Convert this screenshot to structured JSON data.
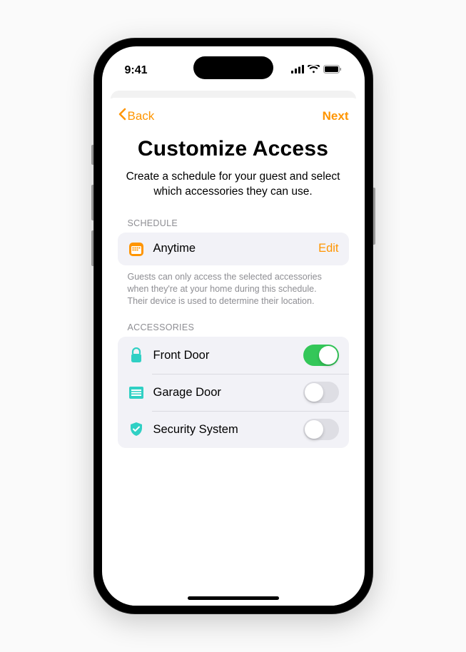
{
  "status": {
    "time": "9:41"
  },
  "nav": {
    "back": "Back",
    "next": "Next"
  },
  "page": {
    "title": "Customize Access",
    "subtitle": "Create a schedule for your guest and select which accessories they can use."
  },
  "schedule": {
    "header": "SCHEDULE",
    "value": "Anytime",
    "edit": "Edit",
    "footer": "Guests can only access the selected accessories when they're at your home during this schedule. Their device is used to determine their location."
  },
  "accessories": {
    "header": "ACCESSORIES",
    "items": [
      {
        "label": "Front Door",
        "enabled": true
      },
      {
        "label": "Garage Door",
        "enabled": false
      },
      {
        "label": "Security System",
        "enabled": false
      }
    ]
  },
  "colors": {
    "accent": "#ff9500",
    "green": "#34c759",
    "teal": "#30d0c4"
  }
}
